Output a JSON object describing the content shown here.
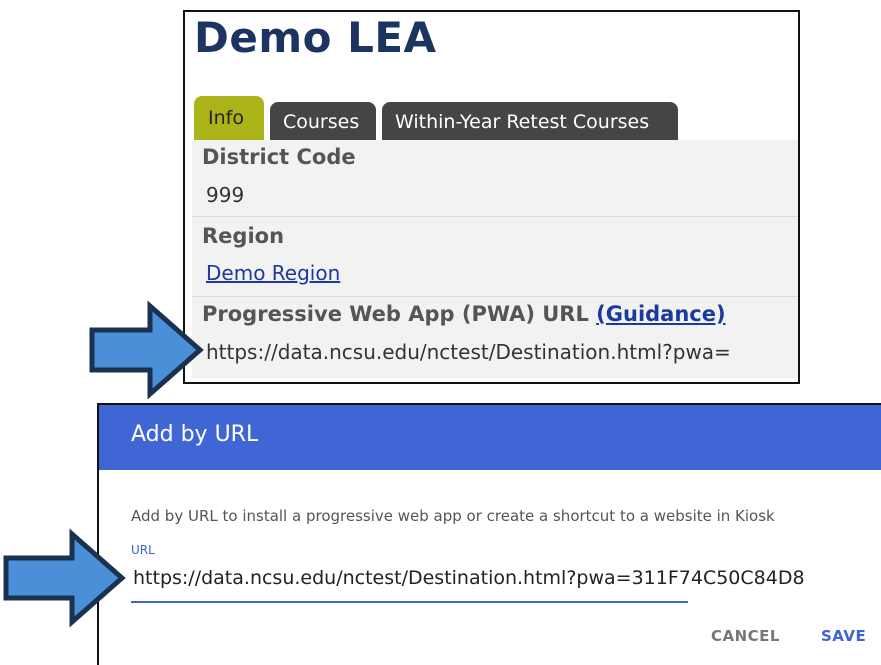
{
  "lea": {
    "title": "Demo LEA",
    "tabs": [
      {
        "label": "Info",
        "active": true
      },
      {
        "label": "Courses",
        "active": false
      },
      {
        "label": "Within-Year Retest Courses",
        "active": false
      }
    ],
    "fields": {
      "district_code_label": "District Code",
      "district_code_value": "999",
      "region_label": "Region",
      "region_value": "Demo Region",
      "pwa_label": "Progressive Web App (PWA) URL",
      "guidance_link": "(Guidance)",
      "pwa_value": "https://data.ncsu.edu/nctest/Destination.html?pwa="
    }
  },
  "dialog": {
    "title": "Add by URL",
    "description": "Add by URL to install a progressive web app or create a shortcut to a website in Kiosk",
    "url_label": "URL",
    "url_value": "https://data.ncsu.edu/nctest/Destination.html?pwa=311F74C50C84D8",
    "cancel_label": "CANCEL",
    "save_label": "SAVE"
  },
  "colors": {
    "title": "#1d3461",
    "tab_active": "#aab418",
    "tab_inactive": "#454545",
    "dialog_header": "#4066d6",
    "arrow_fill": "#4a8fd8",
    "arrow_stroke": "#1a3150"
  },
  "icons": [
    "right-arrow-icon"
  ]
}
